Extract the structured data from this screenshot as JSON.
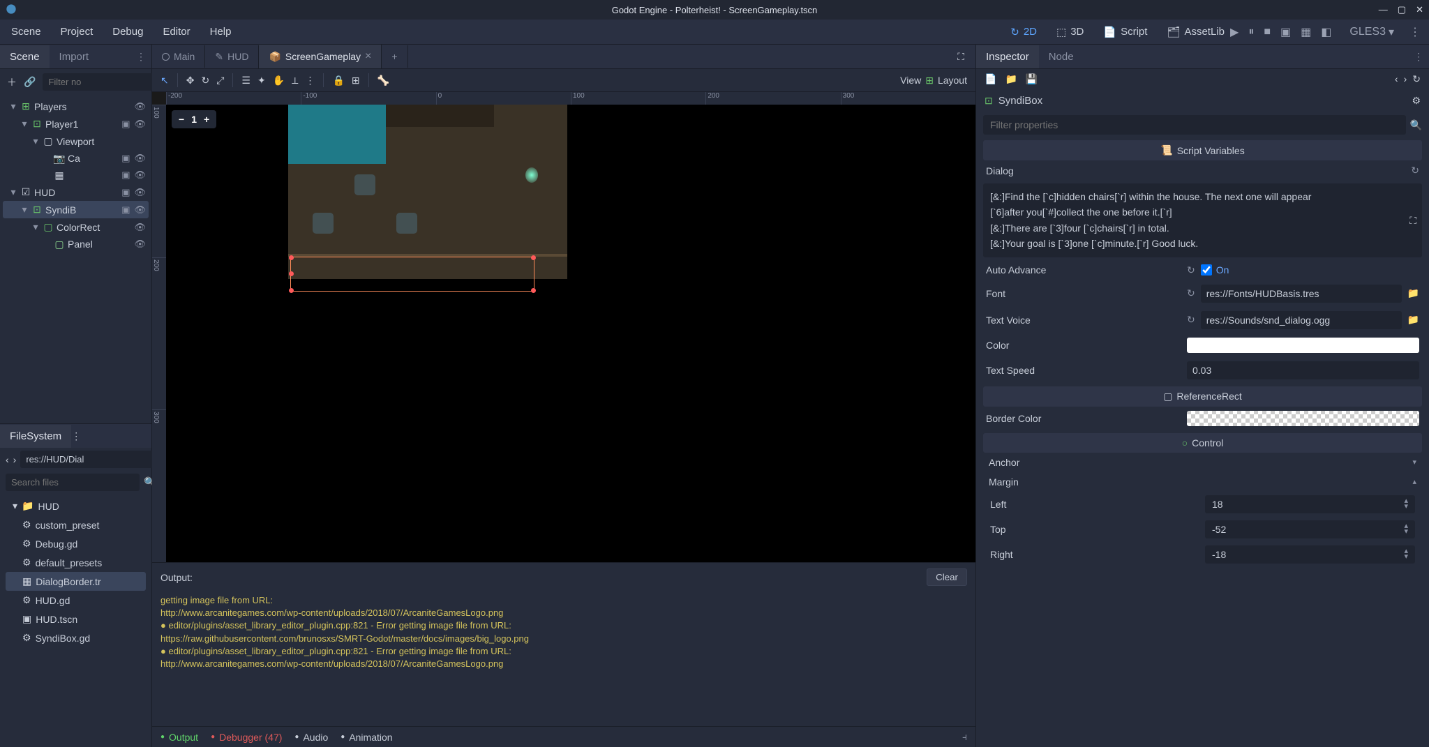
{
  "title": "Godot Engine - Polterheist! - ScreenGameplay.tscn",
  "menus": [
    "Scene",
    "Project",
    "Debug",
    "Editor",
    "Help"
  ],
  "modes": [
    {
      "icon": "↻",
      "label": "2D",
      "active": true
    },
    {
      "icon": "⬚",
      "label": "3D",
      "active": false
    },
    {
      "icon": "📄",
      "label": "Script",
      "active": false
    },
    {
      "icon": "🗂",
      "label": "AssetLib",
      "active": false
    }
  ],
  "gles": "GLES3",
  "left_tabs": {
    "scene": "Scene",
    "import": "Import"
  },
  "scene_filter_placeholder": "Filter no",
  "scene_tree": [
    {
      "indent": 0,
      "toggle": "▾",
      "icon": "⊞",
      "color": "#6ac66a",
      "label": "Players",
      "actions": [
        "👁"
      ]
    },
    {
      "indent": 1,
      "toggle": "▾",
      "icon": "⊡",
      "color": "#6ac66a",
      "label": "Player1",
      "actions": [
        "▣",
        "👁"
      ]
    },
    {
      "indent": 2,
      "toggle": "▾",
      "icon": "▢",
      "color": "#c8ced9",
      "label": "Viewport",
      "actions": []
    },
    {
      "indent": 3,
      "toggle": "",
      "icon": "📷",
      "color": "#7aa7e6",
      "label": "Ca",
      "actions": [
        "▣",
        "👁"
      ]
    },
    {
      "indent": 3,
      "toggle": "",
      "icon": "▦",
      "color": "#c8ced9",
      "label": "",
      "actions": [
        "▣",
        "👁"
      ]
    },
    {
      "indent": 0,
      "toggle": "▾",
      "icon": "☑",
      "color": "#c8ced9",
      "label": "HUD",
      "actions": [
        "▣",
        "👁"
      ]
    },
    {
      "indent": 1,
      "toggle": "▾",
      "icon": "⊡",
      "color": "#6ac66a",
      "label": "SyndiB",
      "actions": [
        "▣",
        "👁"
      ],
      "selected": true
    },
    {
      "indent": 2,
      "toggle": "▾",
      "icon": "▢",
      "color": "#6ac66a",
      "label": "ColorRect",
      "actions": [
        "👁"
      ]
    },
    {
      "indent": 3,
      "toggle": "",
      "icon": "▢",
      "color": "#8fd98f",
      "label": "Panel",
      "actions": [
        "👁"
      ]
    }
  ],
  "fs_title": "FileSystem",
  "fs_path": "res://HUD/Dial",
  "fs_search_placeholder": "Search files",
  "fs_tree": [
    {
      "indent": 0,
      "toggle": "▾",
      "icon": "📁",
      "label": "HUD"
    },
    {
      "indent": 1,
      "icon": "⚙",
      "label": "custom_preset"
    },
    {
      "indent": 1,
      "icon": "⚙",
      "label": "Debug.gd"
    },
    {
      "indent": 1,
      "icon": "⚙",
      "label": "default_presets"
    },
    {
      "indent": 1,
      "icon": "▦",
      "label": "DialogBorder.tr",
      "selected": true
    },
    {
      "indent": 1,
      "icon": "⚙",
      "label": "HUD.gd"
    },
    {
      "indent": 1,
      "icon": "▣",
      "label": "HUD.tscn"
    },
    {
      "indent": 1,
      "icon": "⚙",
      "label": "SyndiBox.gd"
    }
  ],
  "viewport_tabs": [
    {
      "icon": "circle",
      "label": "Main"
    },
    {
      "icon": "edit",
      "label": "HUD"
    },
    {
      "icon": "cube",
      "label": "ScreenGameplay",
      "active": true,
      "closable": true
    }
  ],
  "view_button": "View",
  "layout_button": "Layout",
  "ruler_h": [
    "-200",
    "-100",
    "0",
    "100",
    "200",
    "300"
  ],
  "ruler_v": [
    "100",
    "200",
    "300"
  ],
  "zoom_label": "1",
  "output_title": "Output:",
  "clear_button": "Clear",
  "output_log": [
    {
      "class": "warn",
      "text": "getting image file from URL:"
    },
    {
      "class": "url",
      "text": "http://www.arcanitegames.com/wp-content/uploads/2018/07/ArcaniteGamesLogo.png"
    },
    {
      "class": "warn",
      "text": "● editor/plugins/asset_library_editor_plugin.cpp:821 - Error getting image file from URL:"
    },
    {
      "class": "url",
      "text": "https://raw.githubusercontent.com/brunosxs/SMRT-Godot/master/docs/images/big_logo.png"
    },
    {
      "class": "warn",
      "text": "● editor/plugins/asset_library_editor_plugin.cpp:821 - Error getting image file from URL:"
    },
    {
      "class": "url",
      "text": "http://www.arcanitegames.com/wp-content/uploads/2018/07/ArcaniteGamesLogo.png"
    }
  ],
  "bottom_tabs": {
    "output": "Output",
    "debugger": "Debugger (47)",
    "audio": "Audio",
    "animation": "Animation"
  },
  "inspector_tabs": {
    "inspector": "Inspector",
    "node": "Node"
  },
  "inspector_node_name": "SyndiBox",
  "inspector_filter_placeholder": "Filter properties",
  "script_vars_header": "Script Variables",
  "dialog_label": "Dialog",
  "dialog_text": [
    "[&:]Find the [`c]hidden chairs[`r] within the house. The next one will appear",
    "[`6]after you[`#]collect the one before it.[`r]",
    "[&:]There are [`3]four [`c]chairs[`r] in total.",
    "[&:]Your goal is [`3]one [`c]minute.[`r] Good luck."
  ],
  "auto_advance": {
    "label": "Auto Advance",
    "on_label": "On",
    "checked": true
  },
  "font": {
    "label": "Font",
    "value": "res://Fonts/HUDBasis.tres"
  },
  "text_voice": {
    "label": "Text Voice",
    "value": "res://Sounds/snd_dialog.ogg"
  },
  "color": {
    "label": "Color",
    "value": "#ffffff"
  },
  "text_speed": {
    "label": "Text Speed",
    "value": "0.03"
  },
  "reference_rect_header": "ReferenceRect",
  "border_color": {
    "label": "Border Color"
  },
  "control_header": "Control",
  "anchor_label": "Anchor",
  "margin_label": "Margin",
  "margins": [
    {
      "name": "Left",
      "value": "18"
    },
    {
      "name": "Top",
      "value": "-52"
    },
    {
      "name": "Right",
      "value": "-18"
    }
  ]
}
